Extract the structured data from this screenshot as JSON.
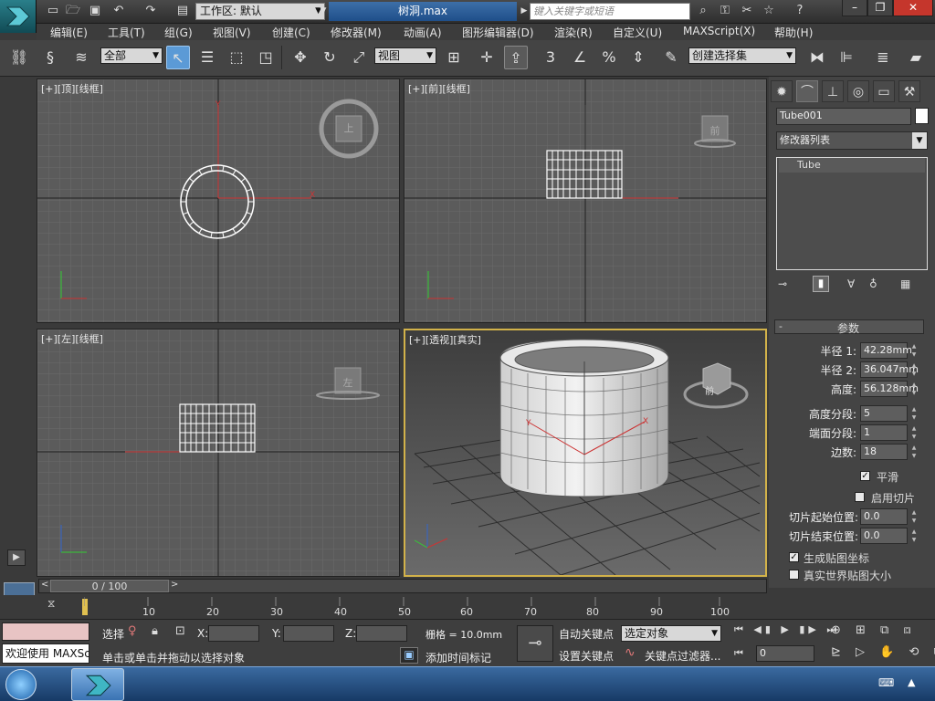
{
  "titlebar": {
    "workspace_label": "工作区: 默认",
    "file_title": "树洞.max",
    "search_placeholder": "键入关键字或短语"
  },
  "menu": [
    "编辑(E)",
    "工具(T)",
    "组(G)",
    "视图(V)",
    "创建(C)",
    "修改器(M)",
    "动画(A)",
    "图形编辑器(D)",
    "渲染(R)",
    "自定义(U)",
    "MAXScript(X)",
    "帮助(H)"
  ],
  "toolbar": {
    "selection_filter": "全部",
    "ref_coord": "视图",
    "named_selection": "创建选择集",
    "snap_label": "3",
    "percent_label": "%"
  },
  "viewports": {
    "top": "[+][顶][线框]",
    "front": "[+][前][线框]",
    "left": "[+][左][线框]",
    "perspective": "[+][透视][真实]",
    "cube_top": "上",
    "cube_front": "前",
    "cube_left": "左",
    "cube_persp": "前"
  },
  "command_panel": {
    "object_name": "Tube001",
    "modifier_list": "修改器列表",
    "stack_item": "Tube",
    "rollout_title": "参数",
    "params": [
      {
        "label": "半径 1:",
        "value": "42.28mm"
      },
      {
        "label": "半径 2:",
        "value": "36.047mm"
      },
      {
        "label": "高度:",
        "value": "56.128mm"
      },
      {
        "label": "高度分段:",
        "value": "5"
      },
      {
        "label": "端面分段:",
        "value": "1"
      },
      {
        "label": "边数:",
        "value": "18"
      }
    ],
    "smooth_label": "平滑",
    "slice_on_label": "启用切片",
    "slice_from_label": "切片起始位置:",
    "slice_from_value": "0.0",
    "slice_to_label": "切片结束位置:",
    "slice_to_value": "0.0",
    "gen_mapping_label": "生成贴图坐标",
    "real_world_label": "真实世界贴图大小",
    "smooth_checked": true,
    "slice_checked": false,
    "gen_mapping_checked": true,
    "real_world_checked": false
  },
  "timeline": {
    "frame_readout": "0 / 100",
    "ticks": [
      "10",
      "20",
      "30",
      "40",
      "50",
      "60",
      "70",
      "80",
      "90",
      "100"
    ]
  },
  "status": {
    "welcome": "欢迎使用 MAXSc",
    "select_label": "选择",
    "prompt": "单击或单击并拖动以选择对象",
    "x_label": "X:",
    "y_label": "Y:",
    "z_label": "Z:",
    "grid": "栅格 = 10.0mm",
    "add_time_tag": "添加时间标记",
    "auto_key": "自动关键点",
    "set_key": "设置关键点",
    "key_filter_target": "选定对象",
    "key_filters": "关键点过滤器...",
    "frame_value": "0"
  },
  "colors": {
    "accent": "#5b9ad6",
    "active_viewport": "#d2b24a",
    "title_bar": "#1f4f8a"
  }
}
